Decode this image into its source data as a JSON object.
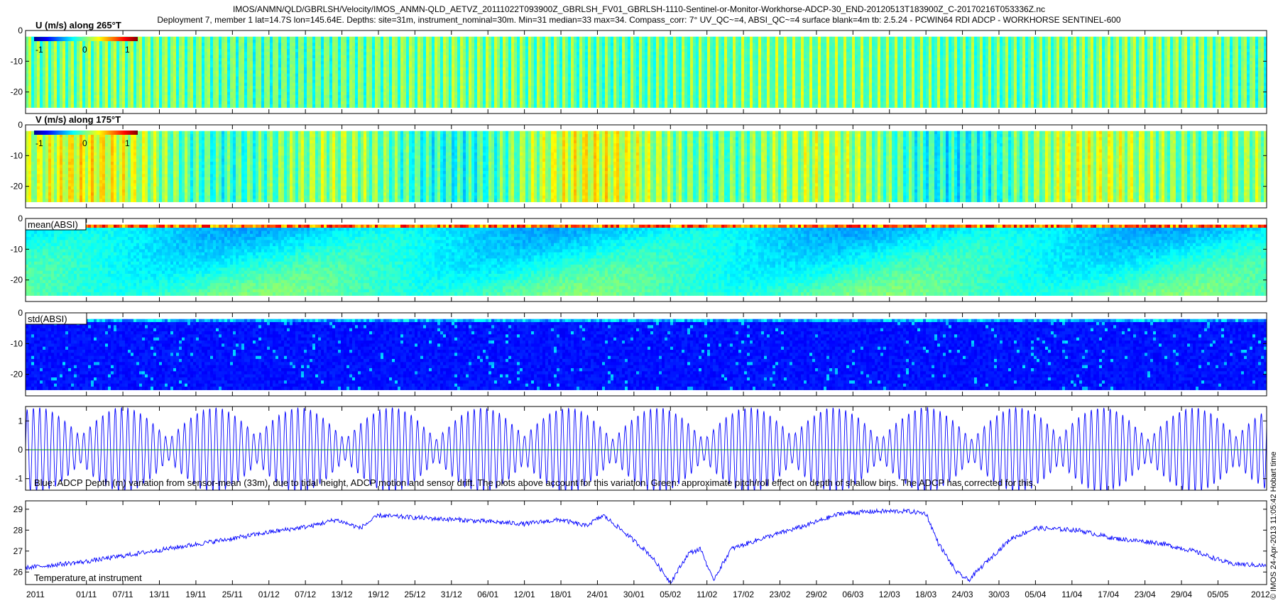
{
  "header": {
    "line1": "IMOS/ANMN/QLD/GBRLSH/Velocity/IMOS_ANMN-QLD_AETVZ_20111022T093900Z_GBRLSH_FV01_GBRLSH-1110-Sentinel-or-Monitor-Workhorse-ADCP-30_END-20120513T183900Z_C-20170216T053336Z.nc",
    "line2": "Deployment 7, member 1 lat=14.7S lon=145.64E. Depths: site=31m, instrument_nominal=30m. Min=31 median=33 max=34. Compass_corr: 7° UV_QC~=4, ABSI_QC~=4 surface blank=4m tb: 2.5.24 - PCWIN64 RDI ADCP - WORKHORSE SENTINEL-600"
  },
  "side_stamp": "© IMOS 24-Apr-2013 11:05:42 Hobart time",
  "colors": {
    "line_blue": "#0000ff",
    "line_green": "#009900",
    "jet_low": "#00008f",
    "jet_high": "#800000"
  },
  "chart_data": [
    {
      "type": "heatmap",
      "label": "U (m/s) along 265°T",
      "colorbar": {
        "ticks": [
          "-1",
          "0",
          "1"
        ],
        "range": [
          -1.3,
          1.3
        ]
      },
      "ylim": [
        -27,
        0
      ],
      "yticks": [
        "0",
        "-10",
        "-20"
      ],
      "yvalues": [
        0,
        -10,
        -20
      ]
    },
    {
      "type": "heatmap",
      "label": "V (m/s) along 175°T",
      "colorbar": {
        "ticks": [
          "-1",
          "0",
          "1"
        ],
        "range": [
          -1.3,
          1.3
        ]
      },
      "ylim": [
        -27,
        0
      ],
      "yticks": [
        "0",
        "-10",
        "-20"
      ],
      "yvalues": [
        0,
        -10,
        -20
      ]
    },
    {
      "type": "heatmap",
      "label": "mean(ABSI)",
      "ylim": [
        -27,
        0
      ],
      "yticks": [
        "0",
        "-10",
        "-20"
      ],
      "yvalues": [
        0,
        -10,
        -20
      ]
    },
    {
      "type": "heatmap",
      "label": "std(ABSI)",
      "ylim": [
        -27,
        0
      ],
      "yticks": [
        "0",
        "-10",
        "-20"
      ],
      "yvalues": [
        0,
        -10,
        -20
      ]
    },
    {
      "type": "line",
      "annotation": "Blue: ADCP Depth (m) variation from sensor-mean (33m), due to tidal height, ADCP motion and sensor drift. The plots above account for this variation. Green: approximate pitch/roll effect on depth of shallow bins. The ADCP has corrected for this.",
      "ylim": [
        -1.4,
        1.5
      ],
      "yticks": [
        "1",
        "0",
        "-1"
      ],
      "yvalues": [
        1,
        0,
        -1
      ],
      "series": [
        {
          "color": "#0000ff",
          "spring_tide_days": [
            2,
            16,
            31,
            45,
            60,
            75,
            89,
            104,
            119,
            133,
            148,
            163,
            177,
            192,
            206
          ],
          "max_amplitude": 1.45
        },
        {
          "color": "#009900",
          "constant": 0
        }
      ]
    },
    {
      "type": "line",
      "label": "Temperature at instrument",
      "ylim": [
        25.4,
        29.4
      ],
      "yticks": [
        "29",
        "28",
        "27",
        "26"
      ],
      "yvalues": [
        29,
        28,
        27,
        26
      ],
      "x": [
        "2011-10-22",
        "2011-11-01",
        "2011-11-12",
        "2011-11-25",
        "2011-12-01",
        "2011-12-08",
        "2011-12-12",
        "2011-12-16",
        "2011-12-19",
        "2011-12-25",
        "2012-01-01",
        "2012-01-12",
        "2012-01-18",
        "2012-01-22",
        "2012-01-25",
        "2012-01-28",
        "2012-02-01",
        "2012-02-02",
        "2012-02-05",
        "2012-02-08",
        "2012-02-10",
        "2012-02-12",
        "2012-02-15",
        "2012-02-20",
        "2012-02-27",
        "2012-03-04",
        "2012-03-10",
        "2012-03-15",
        "2012-03-18",
        "2012-03-20",
        "2012-03-23",
        "2012-03-25",
        "2012-03-28",
        "2012-04-01",
        "2012-04-05",
        "2012-04-12",
        "2012-04-18",
        "2012-04-25",
        "2012-05-01",
        "2012-05-07",
        "2012-05-13"
      ],
      "values": [
        26.2,
        26.5,
        27.0,
        27.6,
        27.9,
        28.2,
        28.5,
        28.1,
        28.7,
        28.6,
        28.5,
        28.3,
        28.5,
        28.2,
        28.7,
        28.0,
        27.0,
        26.7,
        25.5,
        26.9,
        27.1,
        25.6,
        27.1,
        27.6,
        28.2,
        28.8,
        28.9,
        28.9,
        28.8,
        27.4,
        26.0,
        25.6,
        26.5,
        27.6,
        28.1,
        28.0,
        27.6,
        27.4,
        27.0,
        26.4,
        26.3
      ]
    }
  ],
  "xaxis": {
    "labels": [
      "01/11",
      "07/11",
      "13/11",
      "19/11",
      "25/11",
      "01/12",
      "07/12",
      "13/12",
      "19/12",
      "25/12",
      "31/12",
      "06/01",
      "12/01",
      "18/01",
      "24/01",
      "30/01",
      "05/02",
      "11/02",
      "17/02",
      "23/02",
      "29/02",
      "06/03",
      "12/03",
      "18/03",
      "24/03",
      "30/03",
      "05/04",
      "11/04",
      "17/04",
      "23/04",
      "29/04",
      "05/05"
    ],
    "dates": [
      "2011-11-01",
      "2011-11-07",
      "2011-11-13",
      "2011-11-19",
      "2011-11-25",
      "2011-12-01",
      "2011-12-07",
      "2011-12-13",
      "2011-12-19",
      "2011-12-25",
      "2011-12-31",
      "2012-01-06",
      "2012-01-12",
      "2012-01-18",
      "2012-01-24",
      "2012-01-30",
      "2012-02-05",
      "2012-02-11",
      "2012-02-17",
      "2012-02-23",
      "2012-02-29",
      "2012-03-06",
      "2012-03-12",
      "2012-03-18",
      "2012-03-24",
      "2012-03-30",
      "2012-04-05",
      "2012-04-11",
      "2012-04-17",
      "2012-04-23",
      "2012-04-29",
      "2012-05-05"
    ],
    "year_start": "2011",
    "year_end": "2012",
    "range": [
      "2011-10-22",
      "2012-05-13"
    ]
  }
}
